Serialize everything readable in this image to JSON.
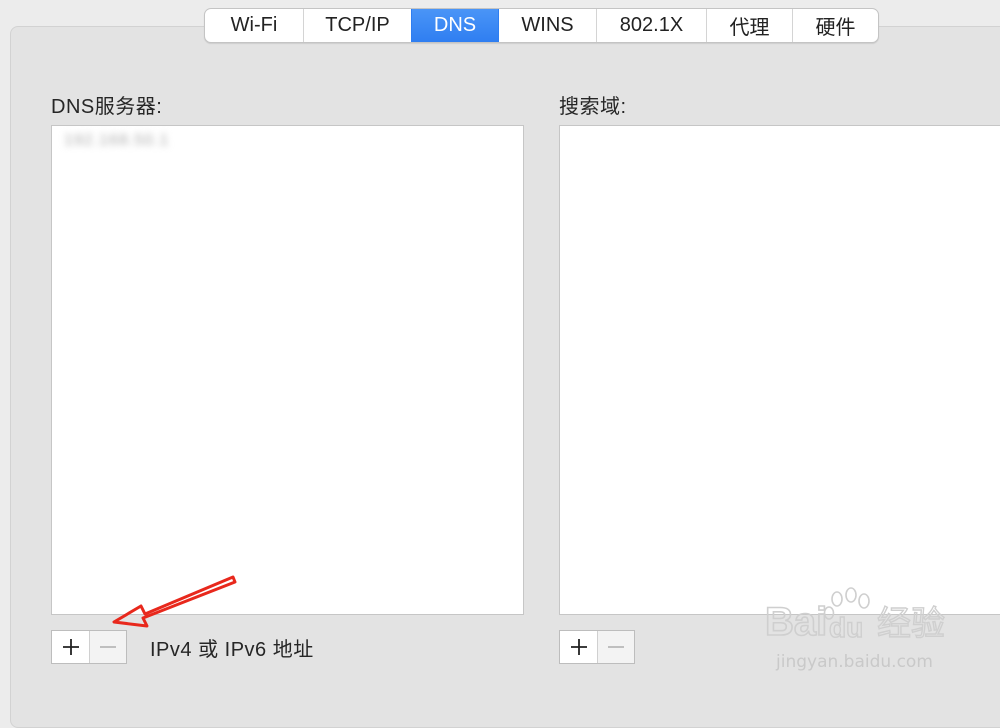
{
  "tabs": [
    {
      "label": "Wi-Fi",
      "active": false
    },
    {
      "label": "TCP/IP",
      "active": false
    },
    {
      "label": "DNS",
      "active": true
    },
    {
      "label": "WINS",
      "active": false
    },
    {
      "label": "802.1X",
      "active": false
    },
    {
      "label": "代理",
      "active": false
    },
    {
      "label": "硬件",
      "active": false
    }
  ],
  "dns_servers": {
    "label": "DNS服务器:",
    "items": [
      "192.168.50.1"
    ],
    "hint": "IPv4 或 IPv6 地址"
  },
  "search_domains": {
    "label": "搜索域:",
    "items": []
  },
  "buttons": {
    "add_icon": "plus-icon",
    "remove_icon": "minus-icon"
  },
  "annotation": {
    "icon": "arrow-icon",
    "color": "#e8281c"
  },
  "watermark": {
    "brand": "Baidu经验",
    "url": "jingyan.baidu.com"
  },
  "colors": {
    "accent": "#3084f2",
    "panel": "#e3e3e3"
  }
}
